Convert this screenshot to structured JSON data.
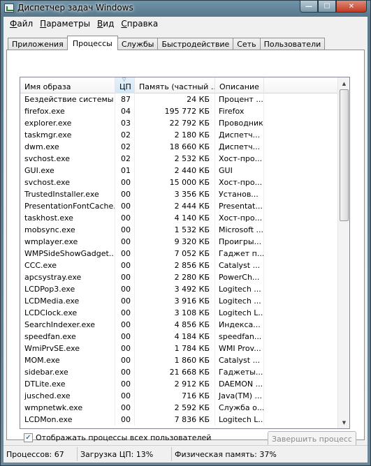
{
  "window": {
    "title": "Диспетчер задач Windows",
    "min": "—",
    "max": "☐",
    "close": "✕"
  },
  "menu": [
    {
      "u": "Ф",
      "rest": "айл"
    },
    {
      "u": "П",
      "rest": "араметры"
    },
    {
      "u": "В",
      "rest": "ид"
    },
    {
      "u": "С",
      "rest": "правка"
    }
  ],
  "tabs": [
    "Приложения",
    "Процессы",
    "Службы",
    "Быстродействие",
    "Сеть",
    "Пользователи"
  ],
  "active_tab": "Процессы",
  "columns": [
    "Имя образа",
    "ЦП",
    "Память (частный ...",
    "Описание"
  ],
  "processes": [
    [
      "Бездействие системы",
      "87",
      "24 КБ",
      "Процент ..."
    ],
    [
      "firefox.exe",
      "04",
      "195 772 КБ",
      "Firefox"
    ],
    [
      "explorer.exe",
      "03",
      "22 792 КБ",
      "Проводник"
    ],
    [
      "taskmgr.exe",
      "02",
      "2 180 КБ",
      "Диспетч..."
    ],
    [
      "dwm.exe",
      "02",
      "18 660 КБ",
      "Диспетч..."
    ],
    [
      "svchost.exe",
      "02",
      "2 532 КБ",
      "Хост-про..."
    ],
    [
      "GUI.exe",
      "01",
      "2 440 КБ",
      "GUI"
    ],
    [
      "svchost.exe",
      "00",
      "15 000 КБ",
      "Хост-про..."
    ],
    [
      "TrustedInstaller.exe",
      "00",
      "3 356 КБ",
      "Установ..."
    ],
    [
      "PresentationFontCache...",
      "00",
      "2 444 КБ",
      "Presentat..."
    ],
    [
      "taskhost.exe",
      "00",
      "4 140 КБ",
      "Хост-про..."
    ],
    [
      "mobsync.exe",
      "00",
      "1 532 КБ",
      "Microsoft ..."
    ],
    [
      "wmplayer.exe",
      "00",
      "9 320 КБ",
      "Проигры..."
    ],
    [
      "WMPSideShowGadget....",
      "00",
      "7 052 КБ",
      "Гаджет п..."
    ],
    [
      "CCC.exe",
      "00",
      "2 856 КБ",
      "Catalyst ..."
    ],
    [
      "apcsystray.exe",
      "00",
      "2 280 КБ",
      "PowerCh..."
    ],
    [
      "LCDPop3.exe",
      "00",
      "3 492 КБ",
      "Logitech ..."
    ],
    [
      "LCDMedia.exe",
      "00",
      "3 916 КБ",
      "Logitech ..."
    ],
    [
      "LCDClock.exe",
      "00",
      "3 108 КБ",
      "Logitech L..."
    ],
    [
      "SearchIndexer.exe",
      "00",
      "4 856 КБ",
      "Индекса..."
    ],
    [
      "speedfan.exe",
      "00",
      "4 184 КБ",
      "speedfan..."
    ],
    [
      "WmiPrvSE.exe",
      "00",
      "1 784 КБ",
      "WMI Prov..."
    ],
    [
      "MOM.exe",
      "00",
      "1 860 КБ",
      "Catalyst ..."
    ],
    [
      "sidebar.exe",
      "00",
      "21 668 КБ",
      "Гаджеты..."
    ],
    [
      "DTLite.exe",
      "00",
      "2 912 КБ",
      "DAEMON ..."
    ],
    [
      "jusched.exe",
      "00",
      "716 КБ",
      "Java(TM) ..."
    ],
    [
      "wmpnetwk.exe",
      "00",
      "2 592 КБ",
      "Служба о..."
    ],
    [
      "LCDMon.exe",
      "00",
      "7 836 КБ",
      "Logitech L..."
    ]
  ],
  "show_all": {
    "checked": true,
    "label": "Отображать процессы всех пользователей",
    "check": "✓"
  },
  "end_button": "Завершить процесс",
  "status": {
    "processes": "Процессов: 67",
    "cpu": "Загрузка ЦП: 13%",
    "memory": "Физическая память: 37%"
  }
}
